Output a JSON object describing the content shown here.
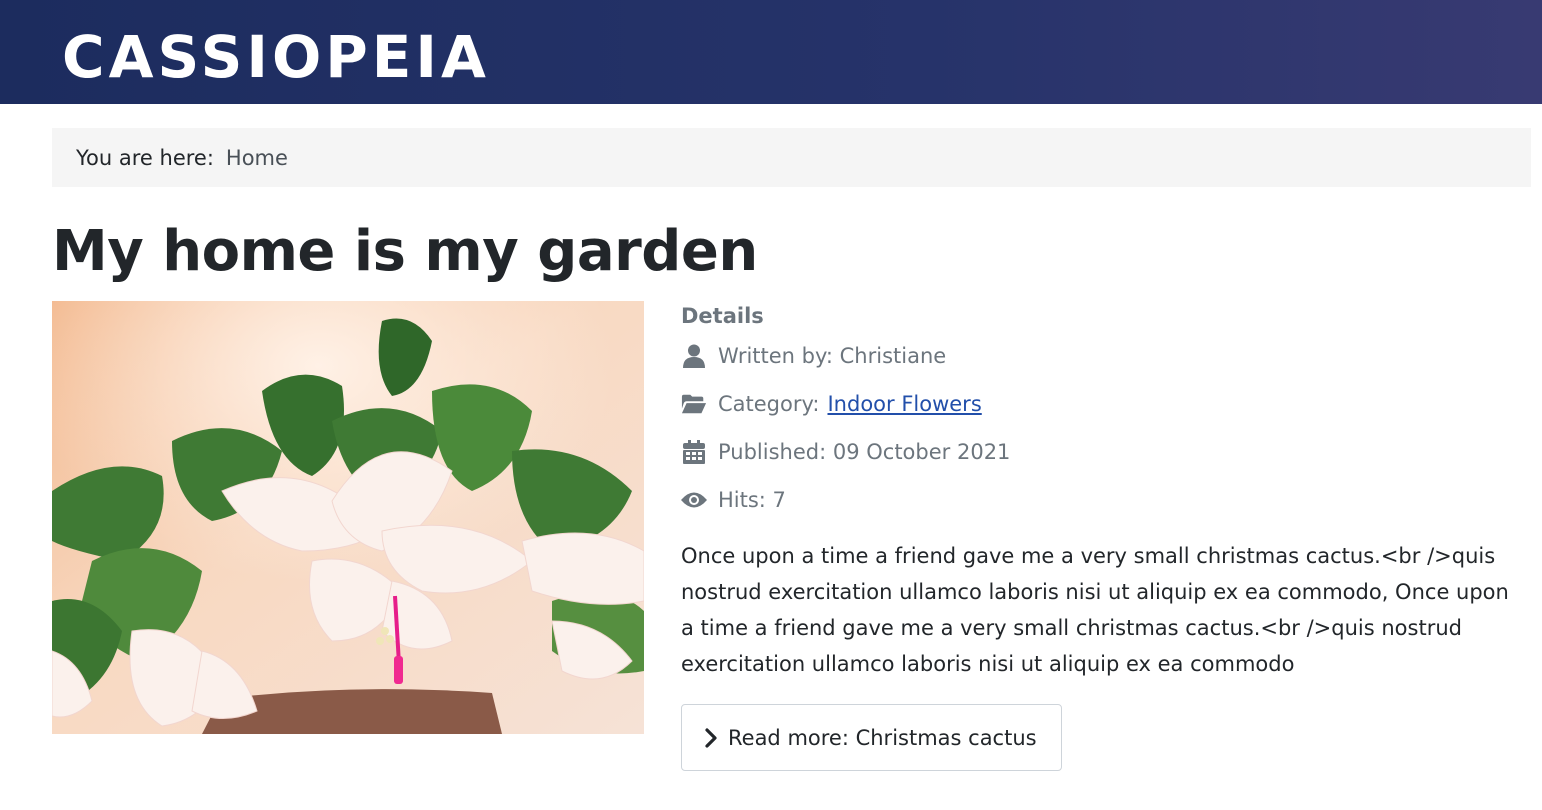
{
  "header": {
    "brand": "CASSIOPEIA",
    "brand_color": "#ffffff",
    "background": "#1c2c5e"
  },
  "breadcrumb": {
    "prefix": "You are here:",
    "home": "Home"
  },
  "article": {
    "title": "My home is my garden",
    "image_icon": "photo-christmas-cactus",
    "details": {
      "heading": "Details",
      "author_label": "Written by: Christiane",
      "author_icon": "user-icon",
      "category_prefix": "Category:",
      "category_link": "Indoor Flowers",
      "category_icon": "folder-open-icon",
      "published_label": "Published: 09 October 2021",
      "published_icon": "calendar-icon",
      "hits_label": "Hits: 7",
      "hits_icon": "eye-icon"
    },
    "intro": "Once upon a time a friend gave me a very small christmas cactus.<br />quis nostrud exercitation ullamco laboris nisi ut aliquip ex ea commodo, Once upon a time a friend gave me a very small christmas cactus.<br />quis nostrud exercitation ullamco laboris nisi ut aliquip ex ea commodo",
    "read_more": "Read more: Christmas cactus",
    "read_more_icon": "chevron-right-icon"
  },
  "colors": {
    "link": "#224faa",
    "muted": "#6c757d",
    "text": "#22262a"
  }
}
